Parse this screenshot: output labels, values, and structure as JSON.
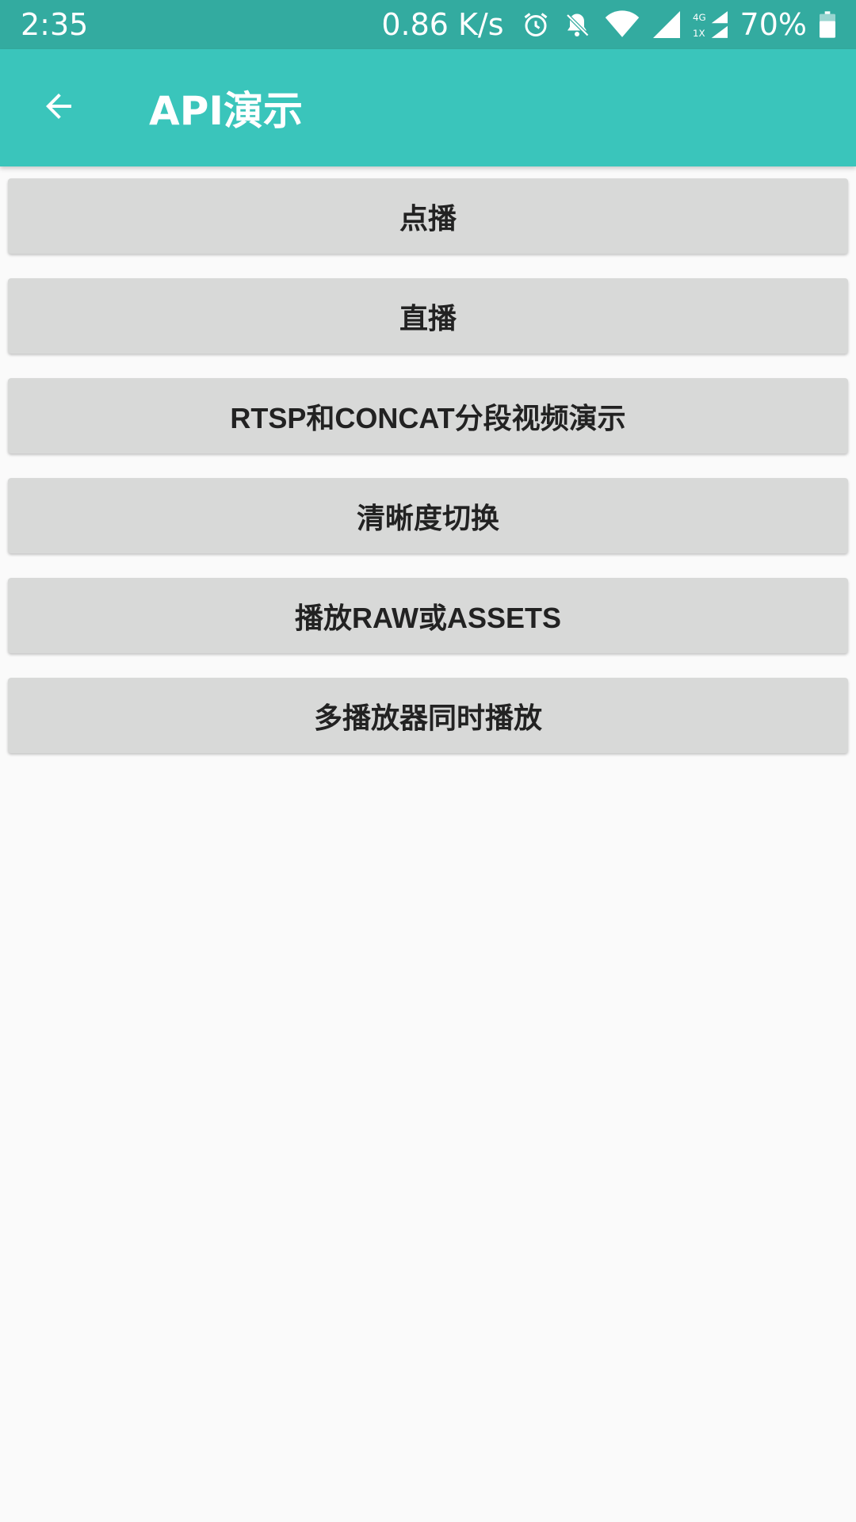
{
  "status_bar": {
    "time": "2:35",
    "net_speed": "0.86 K/s",
    "battery_text": "70%",
    "icons": [
      "alarm-icon",
      "bell-off-icon",
      "wifi-icon",
      "signal-icon",
      "signal-4g-1x-icon",
      "battery-icon"
    ],
    "network_labels": [
      "4G",
      "1X"
    ]
  },
  "app_bar": {
    "title": "API演示",
    "back_icon": "arrow-left-icon",
    "color": "#3ac5bb"
  },
  "menu": {
    "items": [
      {
        "label": "点播"
      },
      {
        "label": "直播"
      },
      {
        "label": "RTSP和CONCAT分段视频演示"
      },
      {
        "label": "清晰度切换"
      },
      {
        "label": "播放RAW或ASSETS"
      },
      {
        "label": "多播放器同时播放"
      }
    ]
  },
  "colors": {
    "status_bar": "#33aba0",
    "button_bg": "#d8d9d8",
    "background": "#fafafa"
  }
}
